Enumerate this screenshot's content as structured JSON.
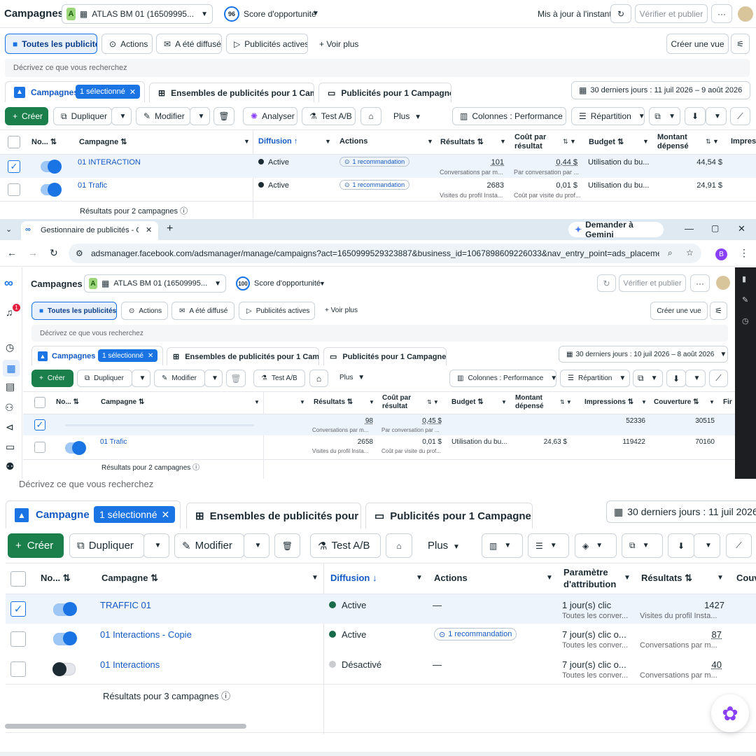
{
  "top": {
    "title": "Campagnes",
    "account_badge": "A",
    "account_name": "ATLAS BM 01 (16509995...",
    "score": "96",
    "score_label": "Score d'opportunité",
    "updated": "Mis à jour à l'instant",
    "publish": "Vérifier et publier",
    "more": "···",
    "tabs": [
      "Toutes les publicités",
      "Actions",
      "A été diffusé",
      "Publicités actives"
    ],
    "voir_plus": "Voir plus",
    "create_view": "Créer une vue",
    "search_placeholder": "Décrivez ce que vous recherchez",
    "tab_campaigns": "Campagnes",
    "selected": "1 sélectionné",
    "tab_adsets": "Ensembles de publicités pour 1 Camp",
    "tab_ads": "Publicités pour 1 Campagne",
    "date_range": "30 derniers jours : 11 juil 2026 – 9 août 2026",
    "toolbar": {
      "create": "Créer",
      "duplicate": "Dupliquer",
      "edit": "Modifier",
      "analyze": "Analyser",
      "abtest": "Test A/B",
      "plus": "Plus",
      "columns": "Colonnes : Performance",
      "breakdown": "Répartition"
    },
    "headers": {
      "no": "No...",
      "campaign": "Campagne",
      "delivery": "Diffusion",
      "actions": "Actions",
      "results": "Résultats",
      "cost": "Coût par résultat",
      "budget": "Budget",
      "spent": "Montant dépensé",
      "impressions": "Impres"
    },
    "rows": [
      {
        "name": "01 INTERACTION",
        "status": "Active",
        "rec": "1 recommandation",
        "results": "101",
        "results_sub": "Conversations par m...",
        "cost": "0,44 $",
        "cost_sub": "Par conversation par ...",
        "budget": "Utilisation du bu...",
        "spent": "44,54 $"
      },
      {
        "name": "01 Trafic",
        "status": "Active",
        "rec": "1 recommandation",
        "results": "2683",
        "results_sub": "Visites du profil Insta...",
        "cost": "0,01 $",
        "cost_sub": "Coût par visite du prof...",
        "budget": "Utilisation du bu...",
        "spent": "24,91 $"
      }
    ],
    "footer": "Résultats pour 2 campagnes"
  },
  "browser": {
    "tab_title": "Gestionnaire de publicités - Gé",
    "new_tab": "+",
    "gemini": "Demander à Gemini",
    "url": "adsmanager.facebook.com/adsmanager/manage/campaigns?act=1650999529323887&business_id=1067898609226033&nav_entry_point=ads_placemen...",
    "profile": "B"
  },
  "mid": {
    "title": "Campagnes",
    "account_badge": "A",
    "account_name": "ATLAS BM 01 (16509995...",
    "score": "100",
    "score_label": "Score d'opportunité",
    "publish": "Vérifier et publier",
    "more": "···",
    "tabs": [
      "Toutes les publicités",
      "Actions",
      "A été diffusé",
      "Publicités actives"
    ],
    "voir_plus": "Voir plus",
    "create_view": "Créer une vue",
    "search_placeholder": "Décrivez ce que vous recherchez",
    "tab_campaigns": "Campagnes",
    "selected": "1 sélectionné",
    "tab_adsets": "Ensembles de publicités pour 1 Camp",
    "tab_ads": "Publicités pour 1 Campagne",
    "date_range": "30 derniers jours : 10 juil 2026 – 8 août 2026",
    "toolbar": {
      "create": "Créer",
      "duplicate": "Dupliquer",
      "edit": "Modifier",
      "abtest": "Test A/B",
      "plus": "Plus",
      "columns": "Colonnes : Performance",
      "breakdown": "Répartition"
    },
    "headers": {
      "no": "No...",
      "campaign": "Campagne",
      "results": "Résultats",
      "cost": "Coût par résultat",
      "budget": "Budget",
      "spent": "Montant dépensé",
      "impressions": "Impressions",
      "reach": "Couverture",
      "fin": "Fir"
    },
    "rows": [
      {
        "name": "",
        "results": "98",
        "results_sub": "Conversations par m...",
        "cost": "0,45 $",
        "cost_sub": "Par conversation par ...",
        "budget": "",
        "spent": "",
        "impressions": "52336",
        "reach": "30515"
      },
      {
        "name": "01 Trafic",
        "results": "2658",
        "results_sub": "Visites du profil Insta...",
        "cost": "0,01 $",
        "cost_sub": "Coût par visite du prof...",
        "budget": "Utilisation du bu...",
        "spent": "24,63 $",
        "impressions": "119422",
        "reach": "70160"
      }
    ],
    "footer": "Résultats pour 2 campagnes",
    "notif_count": "1"
  },
  "bottom": {
    "search_placeholder": "Décrivez ce que vous recherchez",
    "tab_campaigns": "Campagnes",
    "selected": "1 sélectionné",
    "tab_adsets": "Ensembles de publicités pour",
    "tab_ads": "Publicités pour 1 Campagne",
    "date_range": "30 derniers jours : 11 juil 2026 -",
    "toolbar": {
      "create": "Créer",
      "duplicate": "Dupliquer",
      "edit": "Modifier",
      "abtest": "Test A/B",
      "plus": "Plus"
    },
    "headers": {
      "no": "No...",
      "campaign": "Campagne",
      "delivery": "Diffusion",
      "actions": "Actions",
      "attribution": "Paramètre d'attribution",
      "results": "Résultats",
      "cov": "Couv"
    },
    "rows": [
      {
        "name": "TRAFFIC 01",
        "status": "Active",
        "action": "—",
        "attr": "1 jour(s) clic",
        "attr_sub": "Toutes les conver...",
        "results": "1427",
        "results_sub": "Visites du profil Insta..."
      },
      {
        "name": "01 Interactions - Copie",
        "status": "Active",
        "action": "1 recommandation",
        "attr": "7 jour(s) clic o...",
        "attr_sub": "Toutes les conver...",
        "results": "87",
        "results_sub": "Conversations par m..."
      },
      {
        "name": "01 Interactions",
        "status": "Désactivé",
        "action": "—",
        "attr": "7 jour(s) clic o...",
        "attr_sub": "Toutes les conver...",
        "results": "40",
        "results_sub": "Conversations par m..."
      }
    ],
    "footer": "Résultats pour 3 campagnes"
  }
}
